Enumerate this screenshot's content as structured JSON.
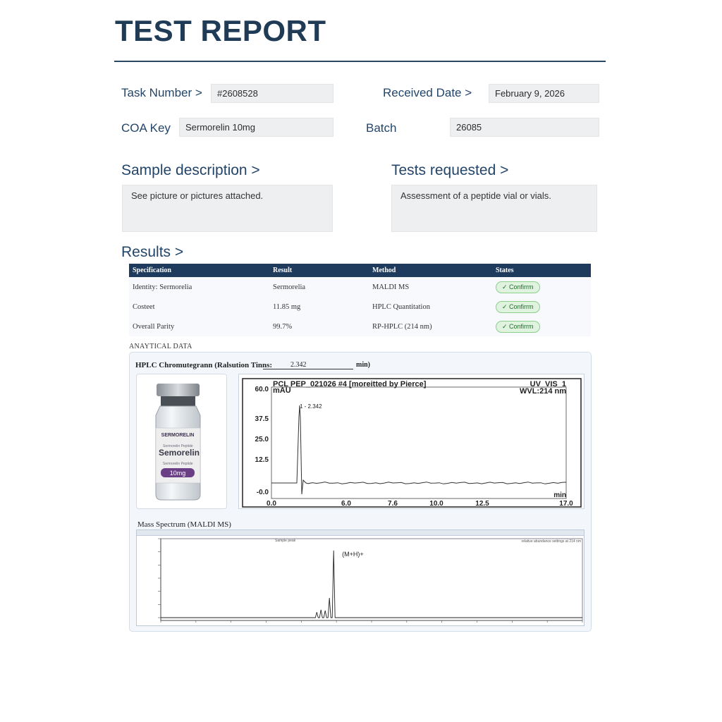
{
  "title": "TEST REPORT",
  "fields": {
    "task_number_label": "Task Number  >",
    "task_number_value": "#2608528",
    "received_date_label": "Received Date  >",
    "received_date_value": "February 9, 2026",
    "coa_key_label": "COA Key",
    "coa_key_value": "Sermorelin 10mg",
    "batch_label": "Batch",
    "batch_value": "26085"
  },
  "sample": {
    "label": "Sample description  >",
    "text": "See picture or pictures attached."
  },
  "tests": {
    "label": "Tests requested  >",
    "text": "Assessment of a peptide vial or vials."
  },
  "results": {
    "label": "Results  >",
    "headers": [
      "Specification",
      "Result",
      "Method",
      "States"
    ],
    "rows": [
      [
        "Identity:  Sermorelia",
        "Sermorelia",
        "MALDI MS",
        "✓ Confirrm"
      ],
      [
        "Costeet",
        "11.85  mg",
        "HPLC Quantitation",
        "✓ Confirrm"
      ],
      [
        "Overall Parity",
        "99.7%",
        "RP-HPLC (214 nm)",
        "✓ Confirrm"
      ]
    ]
  },
  "analytical": {
    "label": "ANAYTICAL DATA",
    "hplc_title": "HPLC Chromutegrann (Ralsution Tinns:",
    "retention_value": "2.342",
    "retention_unit": "min)",
    "vial": {
      "line1": "SERMORELIN",
      "brand": "Semorelin",
      "small": "Sermorelin Peptide",
      "dose": "10mg"
    },
    "chrom_header_left": "PCL PEP_021026 #4 [moreitted by Pierce]",
    "chrom_header_right1": "UV_VIS_1",
    "chrom_header_right2": "WVL:214 nm",
    "chrom_yunit": "mAU",
    "chrom_xunit": "min",
    "peak_label": "1 - 2.342",
    "ms_title": "Mass Spectrum (MALDI MS)",
    "ms_peak_label": "(M+H)+",
    "ms_top_label": "Sample peak",
    "ms_right_note": "relative abundance settings at 214 nm"
  },
  "chart_data": [
    {
      "type": "line",
      "title": "PCL PEP_021026 #4 [moreitted by Pierce]",
      "ylabel": "mAU",
      "xlabel": "min",
      "y_ticks": [
        "60.0",
        "37.5",
        "25.0",
        "12.5",
        "-0.0"
      ],
      "x_ticks": [
        "0.0",
        "6.0",
        "7.6",
        "10.0",
        "12.5",
        "17.0"
      ],
      "ylim": [
        -3,
        60
      ],
      "peaks": [
        {
          "x": 2.342,
          "y": 48,
          "label": "1 - 2.342"
        }
      ]
    },
    {
      "type": "line",
      "title": "Mass Spectrum (MALDI MS)",
      "peaks": [
        {
          "x": 0.37,
          "y": 0.07
        },
        {
          "x": 0.38,
          "y": 0.1
        },
        {
          "x": 0.39,
          "y": 0.09
        },
        {
          "x": 0.4,
          "y": 0.25
        },
        {
          "x": 0.41,
          "y": 0.85,
          "label": "(M+H)+"
        }
      ]
    }
  ],
  "colors": {
    "header_bg": "#1e3a5c",
    "badge_green": "#1e6b2a",
    "title": "#1f3b56"
  }
}
